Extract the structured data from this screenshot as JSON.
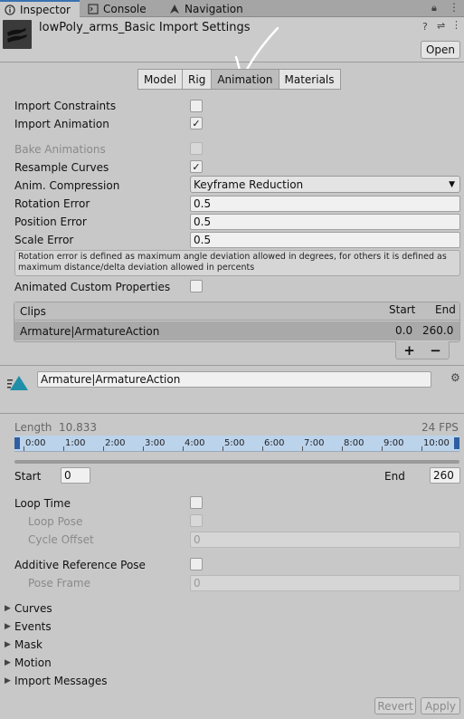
{
  "tabs": [
    {
      "label": "Inspector",
      "icon": "info-icon"
    },
    {
      "label": "Console",
      "icon": "console-icon"
    },
    {
      "label": "Navigation",
      "icon": "navigation-icon"
    }
  ],
  "header": {
    "title": "lowPoly_arms_Basic Import Settings",
    "open_label": "Open"
  },
  "model_tabs": [
    "Model",
    "Rig",
    "Animation",
    "Materials"
  ],
  "selected_tab": "Animation",
  "settings": {
    "import_constraints": {
      "label": "Import Constraints",
      "checked": false
    },
    "import_animation": {
      "label": "Import Animation",
      "checked": true
    },
    "bake_animations": {
      "label": "Bake Animations",
      "checked": false
    },
    "resample_curves": {
      "label": "Resample Curves",
      "checked": true
    },
    "anim_compression": {
      "label": "Anim. Compression",
      "value": "Keyframe Reduction"
    },
    "rotation_error": {
      "label": "Rotation Error",
      "value": "0.5"
    },
    "position_error": {
      "label": "Position Error",
      "value": "0.5"
    },
    "scale_error": {
      "label": "Scale Error",
      "value": "0.5"
    },
    "help_text": "Rotation error is defined as maximum angle deviation allowed in degrees, for others it is defined as maximum distance/delta deviation allowed in percents",
    "animated_custom_properties": {
      "label": "Animated Custom Properties",
      "checked": false
    }
  },
  "clips": {
    "header": {
      "clips": "Clips",
      "start": "Start",
      "end": "End"
    },
    "rows": [
      {
        "name": "Armature|ArmatureAction",
        "start": "0.0",
        "end": "260.0"
      }
    ],
    "add": "+",
    "remove": "−"
  },
  "clip_editor": {
    "name": "Armature|ArmatureAction",
    "length_label": "Length",
    "length_value": "10.833",
    "fps": "24 FPS",
    "ticks": [
      "0:00",
      "1:00",
      "2:00",
      "3:00",
      "4:00",
      "5:00",
      "6:00",
      "7:00",
      "8:00",
      "9:00",
      "10:00"
    ],
    "start_label": "Start",
    "start_value": "0",
    "end_label": "End",
    "end_value": "260",
    "loop_time": {
      "label": "Loop Time",
      "checked": false
    },
    "loop_pose": {
      "label": "Loop Pose"
    },
    "cycle_offset": {
      "label": "Cycle Offset",
      "value": "0"
    },
    "additive_ref": {
      "label": "Additive Reference Pose",
      "checked": false
    },
    "pose_frame": {
      "label": "Pose Frame",
      "value": "0"
    }
  },
  "foldouts": [
    "Curves",
    "Events",
    "Mask",
    "Motion",
    "Import Messages"
  ],
  "footer": {
    "revert": "Revert",
    "apply": "Apply"
  },
  "colors": {
    "timeline": "#bcd3ec",
    "accent": "#3a72b0",
    "clip_icon": "#1f8fa8"
  }
}
